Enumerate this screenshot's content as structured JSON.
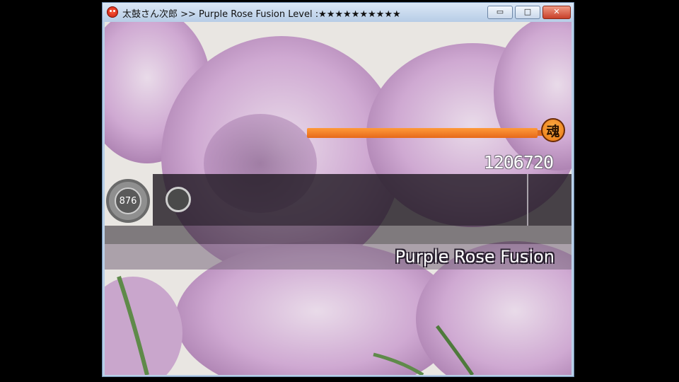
{
  "window": {
    "title": "太鼓さん次郎 >> Purple Rose Fusion Level :★★★★★★★★★★",
    "minimize_glyph": "▭",
    "maximize_glyph": "□",
    "close_glyph": "✕"
  },
  "game": {
    "score": "1206720",
    "combo": "876",
    "soul_icon_label": "魂",
    "soul_gauge_fill": 0.96,
    "song_title": "Purple Rose Fusion"
  },
  "colors": {
    "gauge": "#e6691a",
    "lane": "#1e1820",
    "background": "#c4a9c9"
  }
}
